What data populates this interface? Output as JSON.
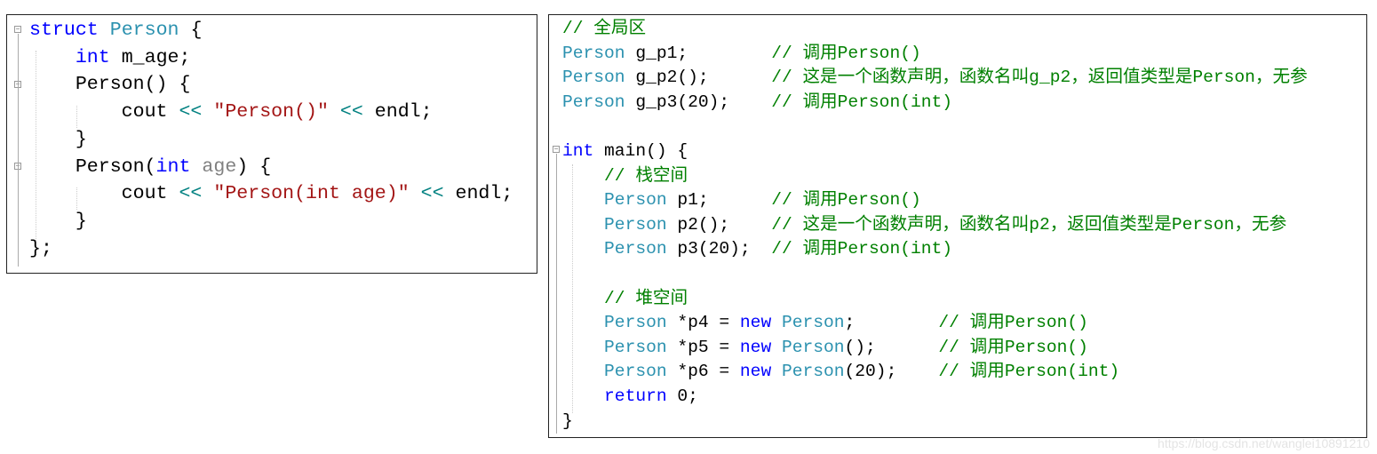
{
  "left_code": [
    [
      [
        "struct",
        "kw"
      ],
      [
        " ",
        "pl"
      ],
      [
        "Person",
        "ty"
      ],
      [
        " {",
        "pl"
      ]
    ],
    [
      [
        "    ",
        "pl"
      ],
      [
        "int",
        "kw"
      ],
      [
        " m_age;",
        "pl"
      ]
    ],
    [
      [
        "    Person() {",
        "pl"
      ]
    ],
    [
      [
        "        cout ",
        "pl"
      ],
      [
        "<<",
        "op"
      ],
      [
        " ",
        "pl"
      ],
      [
        "\"Person()\"",
        "str"
      ],
      [
        " ",
        "pl"
      ],
      [
        "<<",
        "op"
      ],
      [
        " endl;",
        "pl"
      ]
    ],
    [
      [
        "    }",
        "pl"
      ]
    ],
    [
      [
        "    Person(",
        "pl"
      ],
      [
        "int",
        "kw"
      ],
      [
        " ",
        "pl"
      ],
      [
        "age",
        "pa"
      ],
      [
        ") {",
        "pl"
      ]
    ],
    [
      [
        "        cout ",
        "pl"
      ],
      [
        "<<",
        "op"
      ],
      [
        " ",
        "pl"
      ],
      [
        "\"Person(int age)\"",
        "str"
      ],
      [
        " ",
        "pl"
      ],
      [
        "<<",
        "op"
      ],
      [
        " endl;",
        "pl"
      ]
    ],
    [
      [
        "    }",
        "pl"
      ]
    ],
    [
      [
        "};",
        "pl"
      ]
    ]
  ],
  "right_code": [
    [
      [
        "// 全局区",
        "cm"
      ]
    ],
    [
      [
        "Person",
        "ty"
      ],
      [
        " g_p1;        ",
        "pl"
      ],
      [
        "// 调用Person()",
        "cm"
      ]
    ],
    [
      [
        "Person",
        "ty"
      ],
      [
        " g_p2();      ",
        "pl"
      ],
      [
        "// 这是一个函数声明，函数名叫g_p2，返回值类型是Person，无参",
        "cm"
      ]
    ],
    [
      [
        "Person",
        "ty"
      ],
      [
        " g_p3(20);    ",
        "pl"
      ],
      [
        "// 调用Person(int)",
        "cm"
      ]
    ],
    [
      [
        "",
        "pl"
      ]
    ],
    [
      [
        "int",
        "kw"
      ],
      [
        " main() {",
        "pl"
      ]
    ],
    [
      [
        "    ",
        "pl"
      ],
      [
        "// 栈空间",
        "cm"
      ]
    ],
    [
      [
        "    ",
        "pl"
      ],
      [
        "Person",
        "ty"
      ],
      [
        " p1;      ",
        "pl"
      ],
      [
        "// 调用Person()",
        "cm"
      ]
    ],
    [
      [
        "    ",
        "pl"
      ],
      [
        "Person",
        "ty"
      ],
      [
        " p2();    ",
        "pl"
      ],
      [
        "// 这是一个函数声明，函数名叫p2，返回值类型是Person，无参",
        "cm"
      ]
    ],
    [
      [
        "    ",
        "pl"
      ],
      [
        "Person",
        "ty"
      ],
      [
        " p3(20);  ",
        "pl"
      ],
      [
        "// 调用Person(int)",
        "cm"
      ]
    ],
    [
      [
        "",
        "pl"
      ]
    ],
    [
      [
        "    ",
        "pl"
      ],
      [
        "// 堆空间",
        "cm"
      ]
    ],
    [
      [
        "    ",
        "pl"
      ],
      [
        "Person",
        "ty"
      ],
      [
        " *p4 = ",
        "pl"
      ],
      [
        "new",
        "kw"
      ],
      [
        " ",
        "pl"
      ],
      [
        "Person",
        "ty"
      ],
      [
        ";        ",
        "pl"
      ],
      [
        "// 调用Person()",
        "cm"
      ]
    ],
    [
      [
        "    ",
        "pl"
      ],
      [
        "Person",
        "ty"
      ],
      [
        " *p5 = ",
        "pl"
      ],
      [
        "new",
        "kw"
      ],
      [
        " ",
        "pl"
      ],
      [
        "Person",
        "ty"
      ],
      [
        "();      ",
        "pl"
      ],
      [
        "// 调用Person()",
        "cm"
      ]
    ],
    [
      [
        "    ",
        "pl"
      ],
      [
        "Person",
        "ty"
      ],
      [
        " *p6 = ",
        "pl"
      ],
      [
        "new",
        "kw"
      ],
      [
        " ",
        "pl"
      ],
      [
        "Person",
        "ty"
      ],
      [
        "(20);    ",
        "pl"
      ],
      [
        "// 调用Person(int)",
        "cm"
      ]
    ],
    [
      [
        "    ",
        "pl"
      ],
      [
        "return",
        "kw"
      ],
      [
        " 0;",
        "pl"
      ]
    ],
    [
      [
        "}",
        "pl"
      ]
    ]
  ],
  "watermark": "https://blog.csdn.net/wanglei10891210"
}
